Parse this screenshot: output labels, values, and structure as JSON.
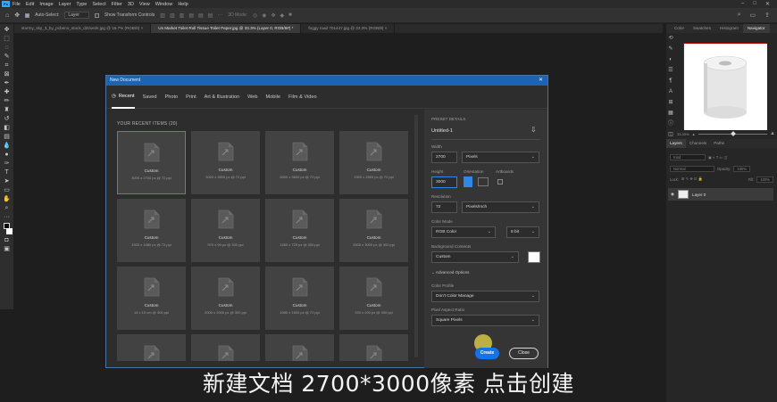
{
  "app": {
    "logo": "Ps",
    "menu": [
      "File",
      "Edit",
      "Image",
      "Layer",
      "Type",
      "Select",
      "Filter",
      "3D",
      "View",
      "Window",
      "Help"
    ],
    "window_controls": [
      "–",
      "□",
      "✕"
    ]
  },
  "options_bar": {
    "auto_select_label": "Auto-Select:",
    "auto_select_value": "Layer",
    "show_transform_label": "Show Transform Controls",
    "mode_3d_label": "3D Mode:"
  },
  "tabs": [
    {
      "label": "stormy_sky_3_by_pcbeno_stock_d22oezk.jpg @ 16.7% (RGB/8) ×",
      "active": false
    },
    {
      "label": "Us Market Toilet Roll Tissue Toilet Paper.jpg @ 33.3% (Layer 0, RGB/8#) *",
      "active": true
    },
    {
      "label": "foggy road 701447.jpg @ 33.3% (RGB/8) ×",
      "active": false
    }
  ],
  "right_panel": {
    "top_tabs": [
      "Color",
      "Swatches",
      "Histogram",
      "Navigator"
    ],
    "active_top_tab": "Navigator",
    "zoom_value": "33.33%",
    "layer_tabs": [
      "Layers",
      "Channels",
      "Paths"
    ],
    "active_layer_tab": "Layers",
    "kind_label": "Kind",
    "blend_mode": "Normal",
    "opacity_label": "Opacity:",
    "opacity_value": "100%",
    "lock_label": "Lock:",
    "fill_label": "Fill:",
    "fill_value": "100%",
    "layer_name": "Layer 0"
  },
  "dialog": {
    "title": "New Document",
    "tabs": [
      "Recent",
      "Saved",
      "Photo",
      "Print",
      "Art & Illustration",
      "Web",
      "Mobile",
      "Film & Video"
    ],
    "active_tab": "Recent",
    "recent_label": "YOUR RECENT ITEMS  (20)",
    "items": [
      {
        "name": "Custom",
        "dims": "3000 x 2700 px @ 72 ppi",
        "selected": true
      },
      {
        "name": "Custom",
        "dims": "3000 x 3600 px @ 72 ppi",
        "selected": false
      },
      {
        "name": "Custom",
        "dims": "3000 x 3600 px @ 72 ppi",
        "selected": false
      },
      {
        "name": "Custom",
        "dims": "1900 x 2500 px @ 72 ppi",
        "selected": false
      },
      {
        "name": "Custom",
        "dims": "1920 x 1080 px @ 72 ppi",
        "selected": false
      },
      {
        "name": "Custom",
        "dims": "970 x 90 px @ 300 ppi",
        "selected": false
      },
      {
        "name": "Custom",
        "dims": "1280 x 720 px @ 300 ppi",
        "selected": false
      },
      {
        "name": "Custom",
        "dims": "2600 x 3000 px @ 300 ppi",
        "selected": false
      },
      {
        "name": "Custom",
        "dims": "14 x 19 cm @ 300 ppi",
        "selected": false
      },
      {
        "name": "Custom",
        "dims": "2000 x 2000 px @ 300 ppi",
        "selected": false
      },
      {
        "name": "Custom",
        "dims": "1080 x 1920 px @ 72 ppi",
        "selected": false
      },
      {
        "name": "Custom",
        "dims": "200 x 200 px @ 300 ppi",
        "selected": false
      },
      {
        "name": "",
        "dims": "",
        "selected": false
      },
      {
        "name": "",
        "dims": "",
        "selected": false
      },
      {
        "name": "",
        "dims": "",
        "selected": false
      },
      {
        "name": "",
        "dims": "",
        "selected": false
      }
    ],
    "details": {
      "section_label": "PRESET DETAILS",
      "preset_name": "Untitled-1",
      "width_label": "Width",
      "width_value": "2700",
      "width_unit": "Pixels",
      "height_label": "Height",
      "height_value": "3000",
      "orientation_label": "Orientation",
      "artboards_label": "Artboards",
      "resolution_label": "Resolution",
      "resolution_value": "72",
      "resolution_unit": "Pixels/Inch",
      "color_mode_label": "Color Mode",
      "color_mode_value": "RGB Color",
      "bit_depth": "8 bit",
      "bg_contents_label": "Background Contents",
      "bg_contents_value": "Custom",
      "advanced_label": "Advanced Options",
      "color_profile_label": "Color Profile",
      "color_profile_value": "Don't Color Manage",
      "pixel_aspect_label": "Pixel Aspect Ratio",
      "pixel_aspect_value": "Square Pixels"
    },
    "create_label": "Create",
    "close_label": "Close"
  },
  "subtitle": "新建文档  2700*3000像素  点击创建",
  "colors": {
    "accent": "#1473e6",
    "title_bar": "#1d63b3",
    "dialog_bg": "#2d2d2d",
    "app_bg": "#1e1e1e"
  }
}
